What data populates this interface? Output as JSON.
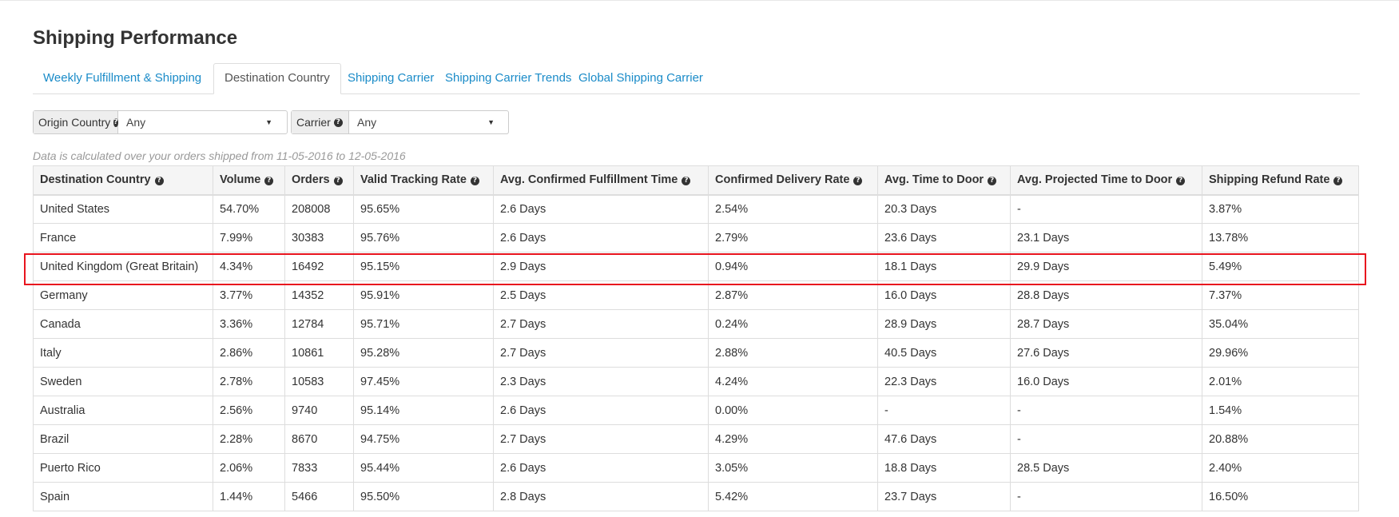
{
  "page": {
    "title": "Shipping Performance"
  },
  "tabs": [
    {
      "label": "Weekly Fulfillment & Shipping"
    },
    {
      "label": "Destination Country"
    },
    {
      "label": "Shipping Carrier"
    },
    {
      "label": "Shipping Carrier Trends"
    },
    {
      "label": "Global Shipping Carrier"
    }
  ],
  "active_tab": "Destination Country",
  "filters": {
    "origin_country": {
      "label": "Origin Country",
      "value": "Any"
    },
    "carrier": {
      "label": "Carrier",
      "value": "Any"
    }
  },
  "note": "Data is calculated over your orders shipped from 11-05-2016 to 12-05-2016",
  "table": {
    "columns": [
      "Destination Country",
      "Volume",
      "Orders",
      "Valid Tracking Rate",
      "Avg. Confirmed Fulfillment Time",
      "Confirmed Delivery Rate",
      "Avg. Time to Door",
      "Avg. Projected Time to Door",
      "Shipping Refund Rate"
    ],
    "rows": [
      [
        "United States",
        "54.70%",
        "208008",
        "95.65%",
        "2.6 Days",
        "2.54%",
        "20.3 Days",
        "-",
        "3.87%"
      ],
      [
        "France",
        "7.99%",
        "30383",
        "95.76%",
        "2.6 Days",
        "2.79%",
        "23.6 Days",
        "23.1 Days",
        "13.78%"
      ],
      [
        "United Kingdom (Great Britain)",
        "4.34%",
        "16492",
        "95.15%",
        "2.9 Days",
        "0.94%",
        "18.1 Days",
        "29.9 Days",
        "5.49%"
      ],
      [
        "Germany",
        "3.77%",
        "14352",
        "95.91%",
        "2.5 Days",
        "2.87%",
        "16.0 Days",
        "28.8 Days",
        "7.37%"
      ],
      [
        "Canada",
        "3.36%",
        "12784",
        "95.71%",
        "2.7 Days",
        "0.24%",
        "28.9 Days",
        "28.7 Days",
        "35.04%"
      ],
      [
        "Italy",
        "2.86%",
        "10861",
        "95.28%",
        "2.7 Days",
        "2.88%",
        "40.5 Days",
        "27.6 Days",
        "29.96%"
      ],
      [
        "Sweden",
        "2.78%",
        "10583",
        "97.45%",
        "2.3 Days",
        "4.24%",
        "22.3 Days",
        "16.0 Days",
        "2.01%"
      ],
      [
        "Australia",
        "2.56%",
        "9740",
        "95.14%",
        "2.6 Days",
        "0.00%",
        "-",
        "-",
        "1.54%"
      ],
      [
        "Brazil",
        "2.28%",
        "8670",
        "94.75%",
        "2.7 Days",
        "4.29%",
        "47.6 Days",
        "-",
        "20.88%"
      ],
      [
        "Puerto Rico",
        "2.06%",
        "7833",
        "95.44%",
        "2.6 Days",
        "3.05%",
        "18.8 Days",
        "28.5 Days",
        "2.40%"
      ],
      [
        "Spain",
        "1.44%",
        "5466",
        "95.50%",
        "2.8 Days",
        "5.42%",
        "23.7 Days",
        "-",
        "16.50%"
      ]
    ]
  },
  "highlighted_row": "United Kingdom (Great Britain)",
  "colors": {
    "link": "#1a8bc8",
    "highlight": "#e8141e",
    "header_bg": "#f5f5f5"
  }
}
